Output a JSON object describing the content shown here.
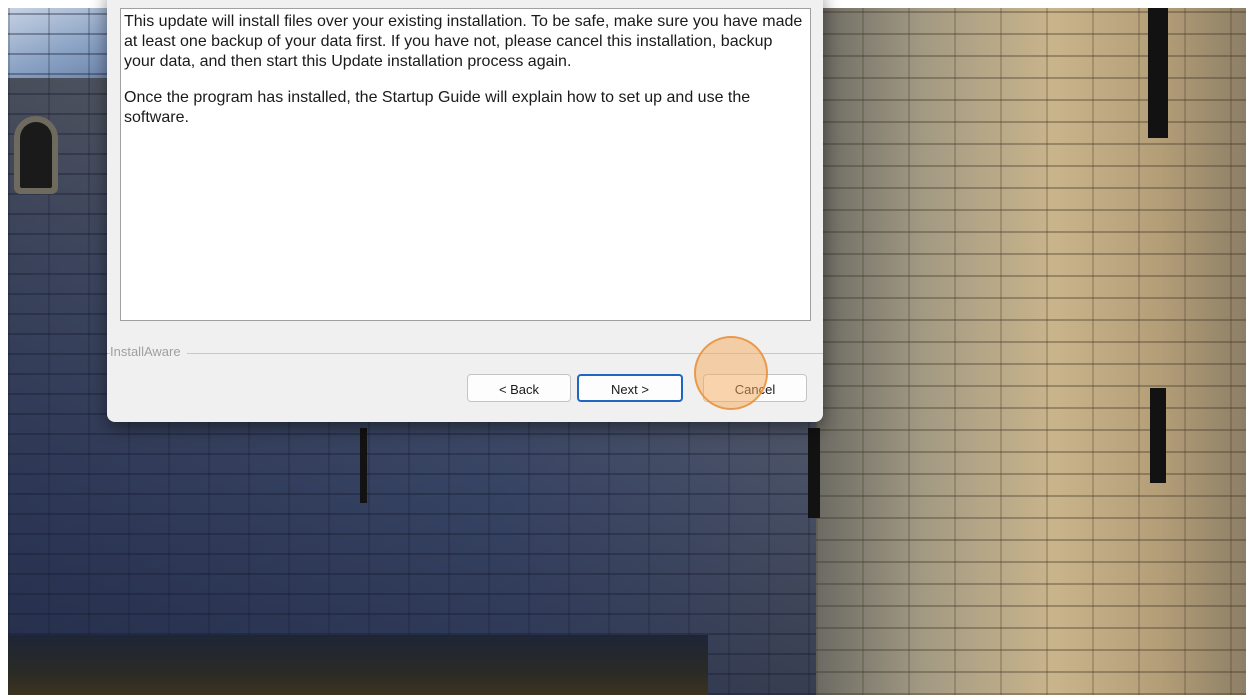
{
  "installer": {
    "paragraphs": [
      "This update will install files over your existing installation. To be safe, make sure you have made at least one backup of your data first. If you have not, please cancel this installation, backup your data, and then start this Update installation process again.",
      "Once the program has installed, the Startup Guide will explain how to set up and use the software."
    ],
    "brand_label": "InstallAware",
    "buttons": {
      "back_label": "< Back",
      "next_label": "Next >",
      "cancel_label": "Cancel"
    }
  },
  "colors": {
    "dialog_bg": "#f0f0f0",
    "focus_border": "#1e66c2",
    "click_highlight": "#f3aa5a"
  }
}
